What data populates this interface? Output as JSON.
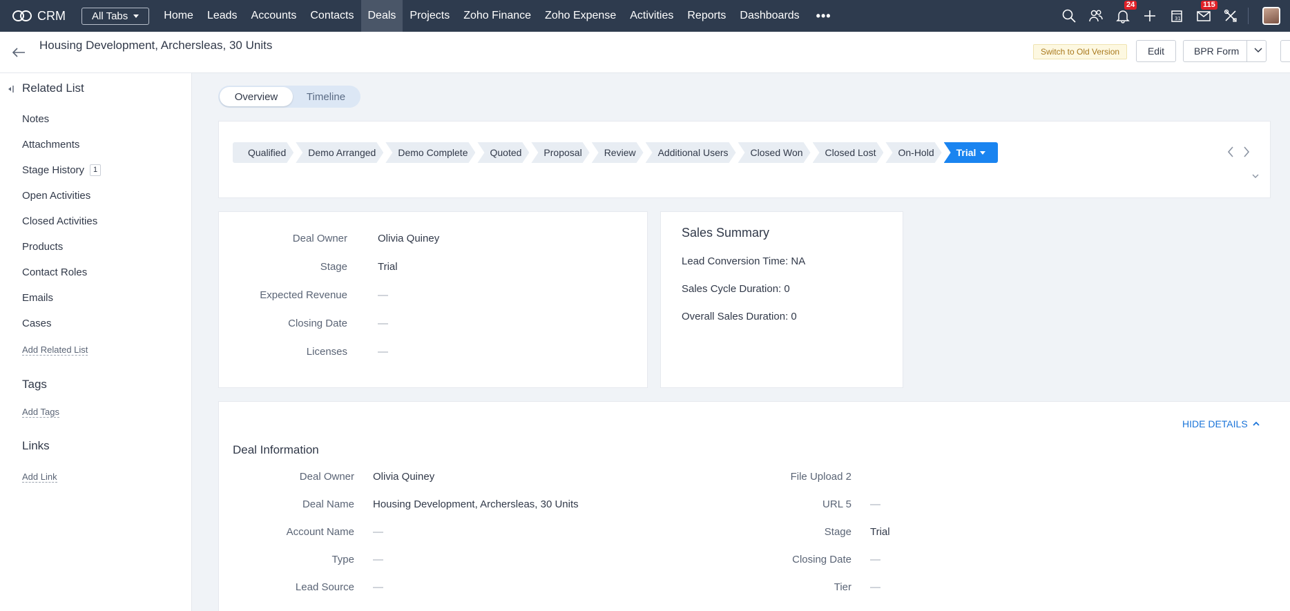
{
  "app": {
    "name": "CRM"
  },
  "topnav": {
    "all_tabs": "All Tabs",
    "tabs": [
      {
        "label": "Home",
        "active": false
      },
      {
        "label": "Leads",
        "active": false
      },
      {
        "label": "Accounts",
        "active": false
      },
      {
        "label": "Contacts",
        "active": false
      },
      {
        "label": "Deals",
        "active": true
      },
      {
        "label": "Projects",
        "active": false
      },
      {
        "label": "Zoho Finance",
        "active": false
      },
      {
        "label": "Zoho Expense",
        "active": false
      },
      {
        "label": "Activities",
        "active": false
      },
      {
        "label": "Reports",
        "active": false
      },
      {
        "label": "Dashboards",
        "active": false
      }
    ],
    "more": "•••",
    "notifications_badge": "24",
    "mail_badge": "115",
    "icons": [
      "search-icon",
      "contacts-icon",
      "bell-icon",
      "plus-icon",
      "calendar-icon",
      "mail-icon",
      "tools-icon",
      "avatar"
    ]
  },
  "record": {
    "title": "Housing Development, Archersleas, 30 Units",
    "switch_old": "Switch to Old Version",
    "edit": "Edit",
    "bpr_form": "BPR Form"
  },
  "sidebar": {
    "related_title": "Related List",
    "items": [
      {
        "label": "Notes"
      },
      {
        "label": "Attachments"
      },
      {
        "label": "Stage History",
        "count": "1"
      },
      {
        "label": "Open Activities"
      },
      {
        "label": "Closed Activities"
      },
      {
        "label": "Products"
      },
      {
        "label": "Contact Roles"
      },
      {
        "label": "Emails"
      },
      {
        "label": "Cases"
      }
    ],
    "add_related": "Add Related List",
    "tags_title": "Tags",
    "add_tags": "Add Tags",
    "links_title": "Links",
    "add_link": "Add Link"
  },
  "view_toggle": {
    "overview": "Overview",
    "timeline": "Timeline",
    "active": "Overview"
  },
  "stages": {
    "items": [
      "Qualified",
      "Demo Arranged",
      "Demo Complete",
      "Quoted",
      "Proposal",
      "Review",
      "Additional Users",
      "Closed Won",
      "Closed Lost",
      "On-Hold"
    ],
    "current": "Trial"
  },
  "key_fields": [
    {
      "label": "Deal Owner",
      "value": "Olivia Quiney"
    },
    {
      "label": "Stage",
      "value": "Trial"
    },
    {
      "label": "Expected Revenue",
      "value": "—"
    },
    {
      "label": "Closing Date",
      "value": "—"
    },
    {
      "label": "Licenses",
      "value": "—"
    }
  ],
  "sales_summary": {
    "title": "Sales Summary",
    "lines": [
      "Lead Conversion Time: NA",
      "Sales Cycle Duration: 0",
      "Overall Sales Duration: 0"
    ]
  },
  "deal_info": {
    "hide_details": "HIDE DETAILS",
    "title": "Deal Information",
    "left": [
      {
        "label": "Deal Owner",
        "value": "Olivia Quiney"
      },
      {
        "label": "Deal Name",
        "value": "Housing Development, Archersleas, 30 Units"
      },
      {
        "label": "Account Name",
        "value": "—"
      },
      {
        "label": "Type",
        "value": "—"
      },
      {
        "label": "Lead Source",
        "value": "—"
      }
    ],
    "right": [
      {
        "label": "File Upload 2",
        "value": ""
      },
      {
        "label": "URL 5",
        "value": "—"
      },
      {
        "label": "Stage",
        "value": "Trial"
      },
      {
        "label": "Closing Date",
        "value": "—"
      },
      {
        "label": "Tier",
        "value": "—"
      }
    ]
  },
  "colors": {
    "nav_bg": "#2e3b4e",
    "accent": "#1a84f0",
    "badge": "#e02027"
  }
}
